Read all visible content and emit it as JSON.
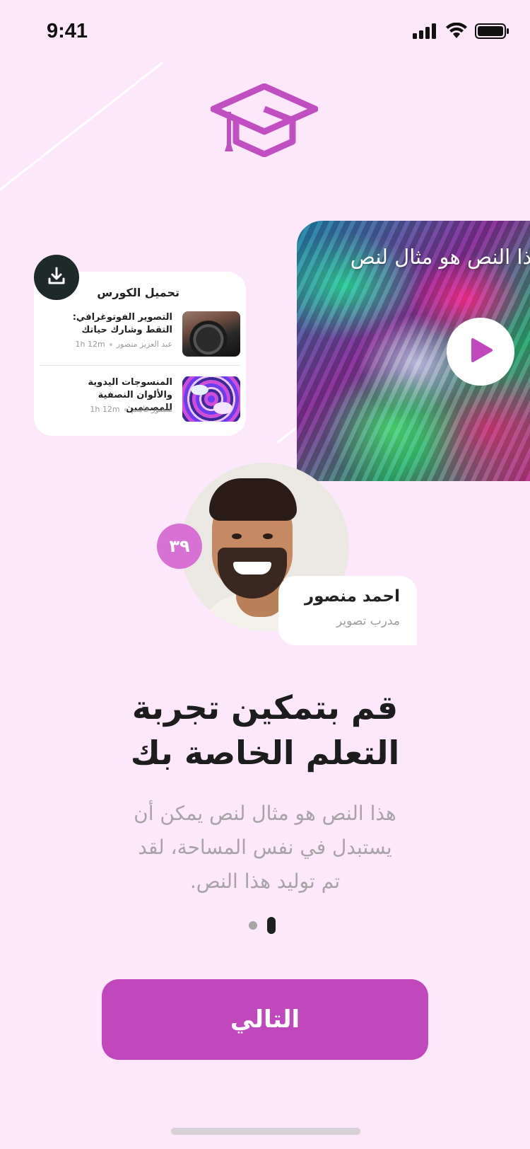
{
  "status_bar": {
    "time": "9:41",
    "icons": [
      "signal-icon",
      "wifi-icon",
      "battery-icon"
    ]
  },
  "logo": {
    "icon": "graduation-cap-icon",
    "color": "#c14fc1"
  },
  "video_card": {
    "title": "هذا النص هو مثال لنص",
    "play_icon": "play-icon"
  },
  "download_card": {
    "title": "تحميل الكورس",
    "download_icon": "download-icon",
    "courses": [
      {
        "name": "التصوير الفوتوغرافي: التقط وشارك حياتك",
        "author": "عبد العزيز منصور",
        "duration": "1h 12m"
      },
      {
        "name": "المنسوجات اليدوية والألوان النصفية للمصممين",
        "author": "منصور قاسم",
        "duration": "1h 12m"
      }
    ]
  },
  "trainer": {
    "badge": "٣٩",
    "name": "احمد منصور",
    "role": "مدرب تصوير"
  },
  "headline": {
    "line1": "قم بتمكين تجربة",
    "line2": "التعلم الخاصة بك"
  },
  "subtext": {
    "line1": "هذا النص هو مثال لنص يمكن أن",
    "line2": "يستبدل في نفس المساحة، لقد",
    "line3": "تم توليد هذا النص."
  },
  "pagination": {
    "total": 2,
    "active": 2
  },
  "next_button": {
    "label": "التالي"
  },
  "colors": {
    "background": "#fde8fb",
    "accent": "#c048bc",
    "badge": "#d771d4",
    "dark": "#1e2a2a"
  }
}
